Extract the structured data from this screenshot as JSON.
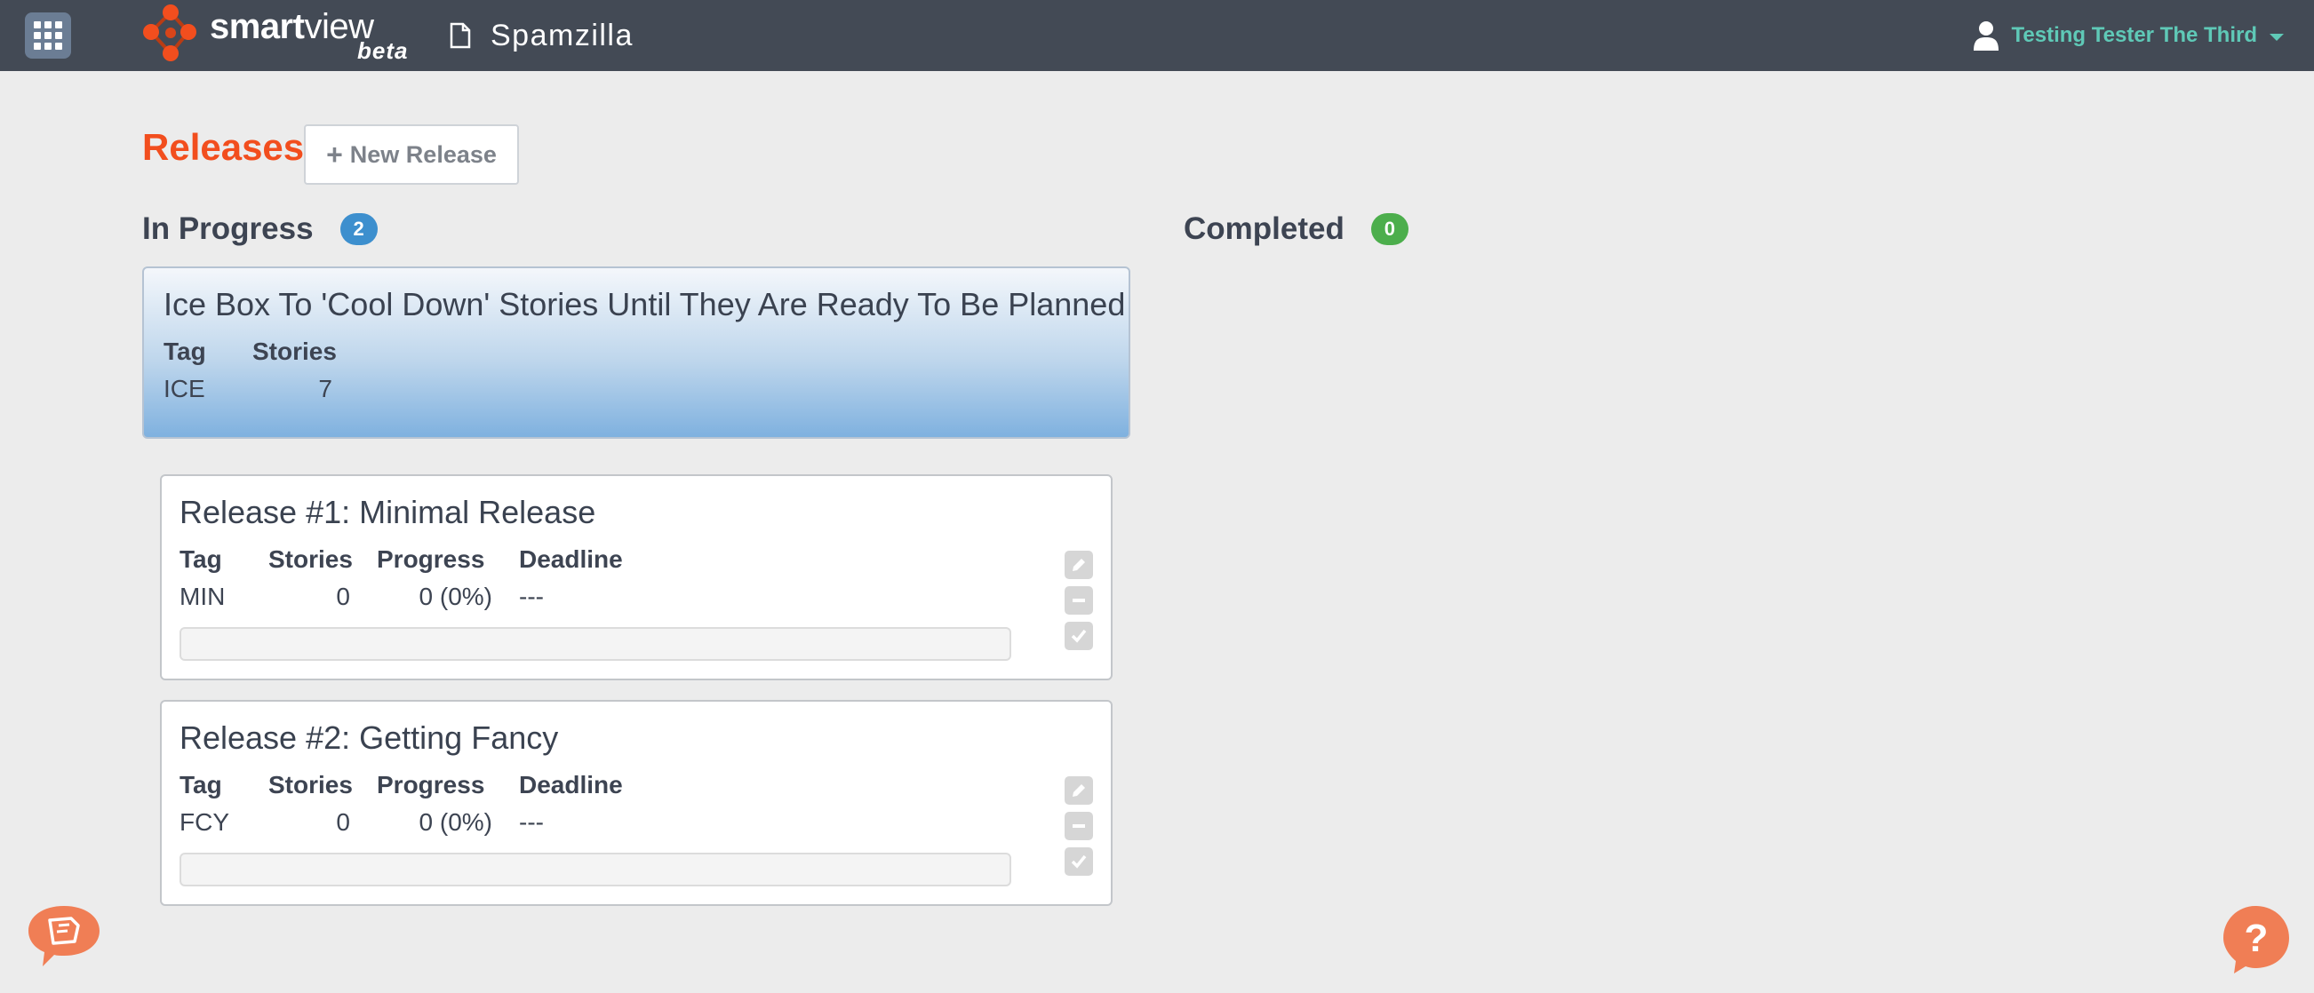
{
  "topbar": {
    "app_name_bold": "smart",
    "app_name_light": "view",
    "app_tag": "beta",
    "project_title": "Spamzilla",
    "user_name": "Testing Tester The Third",
    "colors": {
      "bar": "#434a55",
      "accent": "#5fc9b7",
      "logo": "#f24e1e"
    }
  },
  "page": {
    "title": "Releases",
    "new_release_icon": "+",
    "new_release_label": "New Release"
  },
  "in_progress": {
    "heading": "In Progress",
    "count": "2",
    "badge_color": "#3d8fce"
  },
  "completed": {
    "heading": "Completed",
    "count": "0",
    "badge_color": "#4cae4c"
  },
  "icebox": {
    "title": "Ice Box To 'Cool Down' Stories Until They Are Ready To Be Planned",
    "tag_header": "Tag",
    "stories_header": "Stories",
    "tag": "ICE",
    "stories": "7"
  },
  "releases": [
    {
      "title": "Release #1: Minimal Release",
      "headers": {
        "tag": "Tag",
        "stories": "Stories",
        "progress": "Progress",
        "deadline": "Deadline"
      },
      "tag": "MIN",
      "stories": "0",
      "progress": "0 (0%)",
      "progress_fraction": 0,
      "deadline": "---",
      "actions": [
        "pencil-icon",
        "minus-icon",
        "check-icon"
      ]
    },
    {
      "title": "Release #2: Getting Fancy",
      "headers": {
        "tag": "Tag",
        "stories": "Stories",
        "progress": "Progress",
        "deadline": "Deadline"
      },
      "tag": "FCY",
      "stories": "0",
      "progress": "0 (0%)",
      "progress_fraction": 0,
      "deadline": "---",
      "actions": [
        "pencil-icon",
        "minus-icon",
        "check-icon"
      ]
    }
  ],
  "floating": {
    "left_icon": "book-icon",
    "right_icon": "help-icon",
    "color": "#f07e55"
  }
}
